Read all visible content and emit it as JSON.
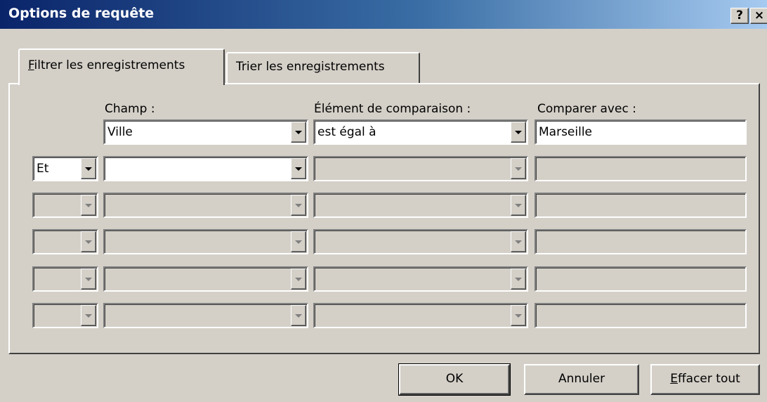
{
  "window": {
    "title": "Options de requête",
    "help_label": "?",
    "close_label": "×"
  },
  "tabs": [
    {
      "mnemonic": "F",
      "rest": "iltrer les enregistrements",
      "active": true
    },
    {
      "pre": "Trier les enre",
      "mnemonic": "g",
      "post": "istrements",
      "active": false
    }
  ],
  "columns": {
    "conjunction": "",
    "field": "Champ :",
    "comparison": "Élément de comparaison :",
    "compare_with": "Comparer avec :"
  },
  "rows": [
    {
      "conjunction": "",
      "field": "Ville",
      "comparison": "est égal à",
      "value": "Marseille",
      "enabled": true
    },
    {
      "conjunction": "Et",
      "field": "",
      "comparison": "",
      "value": "",
      "enabled": "partial"
    },
    {
      "conjunction": "",
      "field": "",
      "comparison": "",
      "value": "",
      "enabled": false
    },
    {
      "conjunction": "",
      "field": "",
      "comparison": "",
      "value": "",
      "enabled": false
    },
    {
      "conjunction": "",
      "field": "",
      "comparison": "",
      "value": "",
      "enabled": false
    },
    {
      "conjunction": "",
      "field": "",
      "comparison": "",
      "value": "",
      "enabled": false
    }
  ],
  "buttons": {
    "ok": "OK",
    "cancel": "Annuler",
    "clear_mnemonic": "E",
    "clear_rest": "ffacer tout"
  }
}
